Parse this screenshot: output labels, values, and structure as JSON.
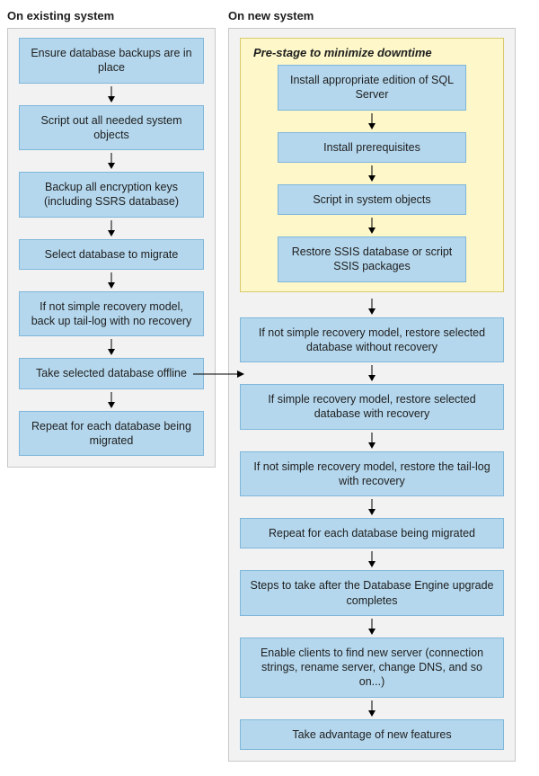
{
  "existing": {
    "heading": "On existing system",
    "steps": [
      "Ensure database backups are in place",
      "Script out all needed system objects",
      "Backup all encryption keys (including SSRS database)",
      "Select database to migrate",
      "If not simple recovery model, back up tail-log with no recovery",
      "Take selected database offline",
      "Repeat for each database being migrated"
    ]
  },
  "new": {
    "heading": "On new system",
    "prestage_title": "Pre-stage to minimize downtime",
    "prestage_steps": [
      "Install appropriate edition of SQL Server",
      "Install prerequisites",
      "Script in system objects",
      "Restore SSIS database or script SSIS packages"
    ],
    "steps": [
      "If not simple recovery model, restore selected database without recovery",
      "If simple recovery model, restore selected database with recovery",
      "If not simple recovery model, restore the tail-log with recovery",
      "Repeat for each database being migrated",
      "Steps to take after the Database Engine upgrade completes",
      "Enable clients to find new server (connection strings, rename server, change DNS, and so on...)",
      "Take advantage of new features"
    ]
  },
  "chart_data": {
    "type": "flowchart",
    "columns": [
      {
        "title": "On existing system",
        "nodes": [
          {
            "id": "e1",
            "label": "Ensure database backups are in place"
          },
          {
            "id": "e2",
            "label": "Script out all needed system objects"
          },
          {
            "id": "e3",
            "label": "Backup all encryption keys (including SSRS database)"
          },
          {
            "id": "e4",
            "label": "Select database to migrate"
          },
          {
            "id": "e5",
            "label": "If not simple recovery model, back up tail-log with no recovery"
          },
          {
            "id": "e6",
            "label": "Take selected database offline"
          },
          {
            "id": "e7",
            "label": "Repeat for each database being migrated"
          }
        ]
      },
      {
        "title": "On new system",
        "groups": [
          {
            "title": "Pre-stage to minimize downtime",
            "nodes": [
              {
                "id": "p1",
                "label": "Install appropriate edition of SQL Server"
              },
              {
                "id": "p2",
                "label": "Install prerequisites"
              },
              {
                "id": "p3",
                "label": "Script in system objects"
              },
              {
                "id": "p4",
                "label": "Restore SSIS database or script SSIS packages"
              }
            ]
          }
        ],
        "nodes": [
          {
            "id": "n1",
            "label": "If not simple recovery model, restore selected database without recovery"
          },
          {
            "id": "n2",
            "label": "If simple recovery model, restore selected database with recovery"
          },
          {
            "id": "n3",
            "label": "If not simple recovery model, restore the tail-log with recovery"
          },
          {
            "id": "n4",
            "label": "Repeat for each database being migrated"
          },
          {
            "id": "n5",
            "label": "Steps to take after the Database Engine upgrade completes"
          },
          {
            "id": "n6",
            "label": "Enable clients to find new server (connection strings, rename server, change DNS, and so on...)"
          },
          {
            "id": "n7",
            "label": "Take advantage of new features"
          }
        ]
      }
    ],
    "edges": [
      {
        "from": "e1",
        "to": "e2"
      },
      {
        "from": "e2",
        "to": "e3"
      },
      {
        "from": "e3",
        "to": "e4"
      },
      {
        "from": "e4",
        "to": "e5"
      },
      {
        "from": "e5",
        "to": "e6"
      },
      {
        "from": "e6",
        "to": "e7"
      },
      {
        "from": "p1",
        "to": "p2"
      },
      {
        "from": "p2",
        "to": "p3"
      },
      {
        "from": "p3",
        "to": "p4"
      },
      {
        "from": "p4",
        "to": "n1"
      },
      {
        "from": "n1",
        "to": "n2"
      },
      {
        "from": "n2",
        "to": "n3"
      },
      {
        "from": "n3",
        "to": "n4"
      },
      {
        "from": "n4",
        "to": "n5"
      },
      {
        "from": "n5",
        "to": "n6"
      },
      {
        "from": "n6",
        "to": "n7"
      },
      {
        "from": "e6",
        "to": "n1",
        "note": "cross-column"
      }
    ]
  }
}
